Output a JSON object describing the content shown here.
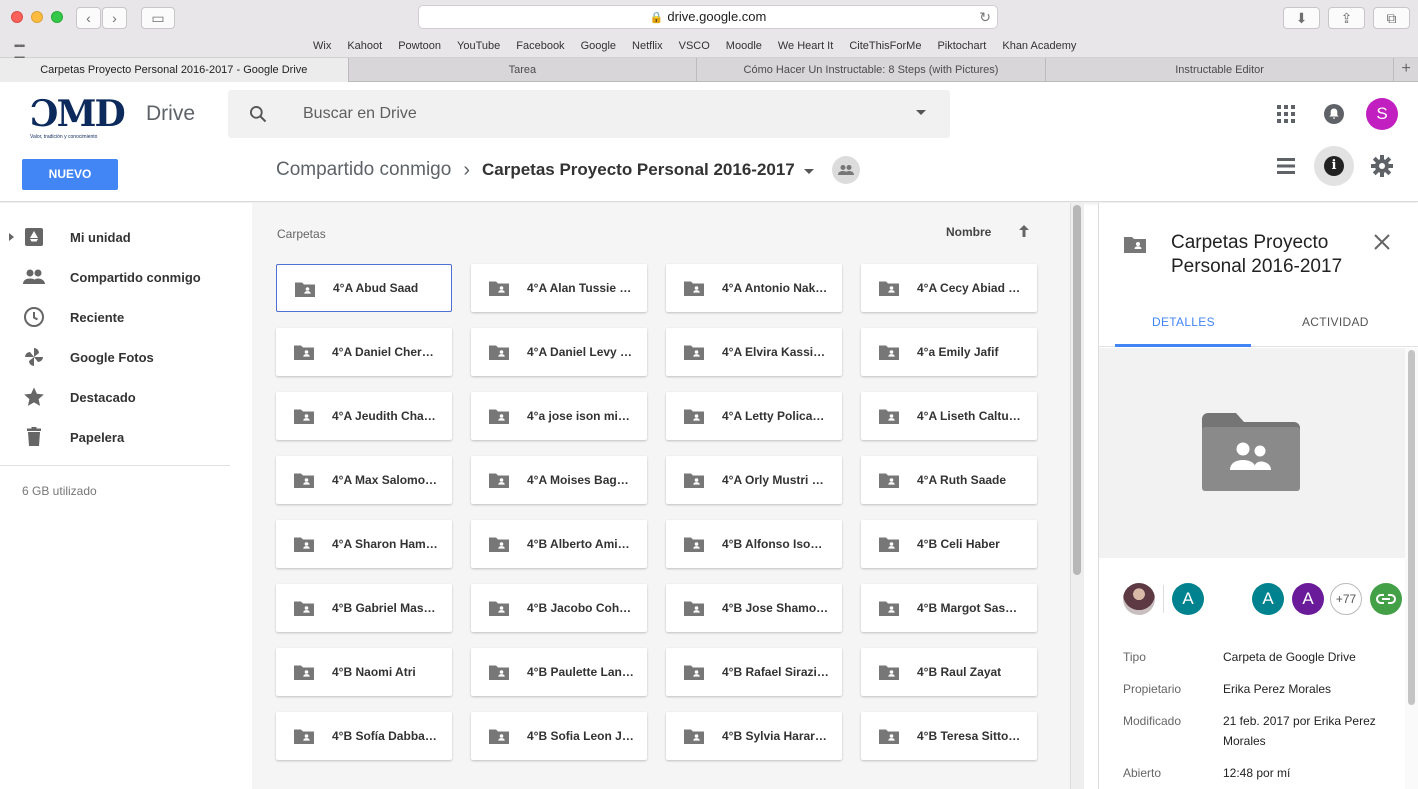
{
  "browser": {
    "url": "drive.google.com",
    "bookmarks": [
      "Wix",
      "Kahoot",
      "Powtoon",
      "YouTube",
      "Facebook",
      "Google",
      "Netflix",
      "VSCO",
      "Moodle",
      "We Heart It",
      "CiteThisForMe",
      "Piktochart",
      "Khan Academy"
    ],
    "tabs": [
      {
        "label": "Carpetas Proyecto Personal 2016-2017 - Google Drive",
        "active": true
      },
      {
        "label": "Tarea",
        "active": false
      },
      {
        "label": "Cómo Hacer Un Instructable: 8 Steps (with Pictures)",
        "active": false
      },
      {
        "label": "Instructable Editor",
        "active": false
      }
    ]
  },
  "header": {
    "logo_text": "ƆMD",
    "logo_tagline": "Valor, tradición y conocimiento",
    "product": "Drive",
    "search_placeholder": "Buscar en Drive",
    "new_button": "NUEVO",
    "user_initial": "S",
    "breadcrumb": {
      "parent": "Compartido conmigo",
      "current": "Carpetas Proyecto Personal 2016-2017"
    }
  },
  "sidebar": {
    "items": [
      {
        "label": "Mi unidad",
        "icon": "drive-icon"
      },
      {
        "label": "Compartido conmigo",
        "icon": "people-icon"
      },
      {
        "label": "Reciente",
        "icon": "clock-icon"
      },
      {
        "label": "Google Fotos",
        "icon": "pinwheel-icon"
      },
      {
        "label": "Destacado",
        "icon": "star-icon"
      },
      {
        "label": "Papelera",
        "icon": "trash-icon"
      }
    ],
    "storage": "6 GB utilizado"
  },
  "main": {
    "section": "Carpetas",
    "sort_label": "Nombre",
    "folders": [
      "4°A Abud Saad",
      "4°A Alan Tussie …",
      "4°A Antonio Nak…",
      "4°A Cecy Abiad …",
      "4°A Daniel Cher…",
      "4°A Daniel Levy …",
      "4°A Elvira Kassi…",
      "4°a Emily Jafif",
      "4°A Jeudith Cha…",
      "4°a jose ison mi…",
      "4°A Letty Polica…",
      "4°A Liseth Caltu…",
      "4°A Max Salomo…",
      "4°A Moises Bag…",
      "4°A Orly Mustri …",
      "4°A Ruth Saade",
      "4°A Sharon Ham…",
      "4°B Alberto Ami…",
      "4°B Alfonso Iso…",
      "4°B Celi Haber",
      "4°B Gabriel Mas…",
      "4°B Jacobo Coh…",
      "4°B Jose Shamo…",
      "4°B Margot Sas…",
      "4°B Naomi Atri",
      "4°B Paulette Lan…",
      "4°B Rafael Sirazi…",
      "4°B Raul Zayat",
      "4°B Sofía Dabba…",
      "4°B Sofia Leon J…",
      "4°B Sylvia Harar…",
      "4°B Teresa Sitto…"
    ]
  },
  "details": {
    "title": "Carpetas Proyecto Personal 2016-2017",
    "tab_details": "DETALLES",
    "tab_activity": "ACTIVIDAD",
    "people": [
      {
        "initial": "A",
        "color": "#00838f"
      },
      {
        "initial": "A",
        "color": "#00838f"
      },
      {
        "initial": "A",
        "color": "#6a1b9a"
      }
    ],
    "more_people": "+77",
    "properties": [
      {
        "key": "Tipo",
        "value": "Carpeta de Google Drive"
      },
      {
        "key": "Propietario",
        "value": "Erika Perez Morales"
      },
      {
        "key": "Modificado",
        "value": "21 feb. 2017 por Erika Perez Morales"
      },
      {
        "key": "Abierto",
        "value": "12:48 por mí"
      }
    ]
  }
}
